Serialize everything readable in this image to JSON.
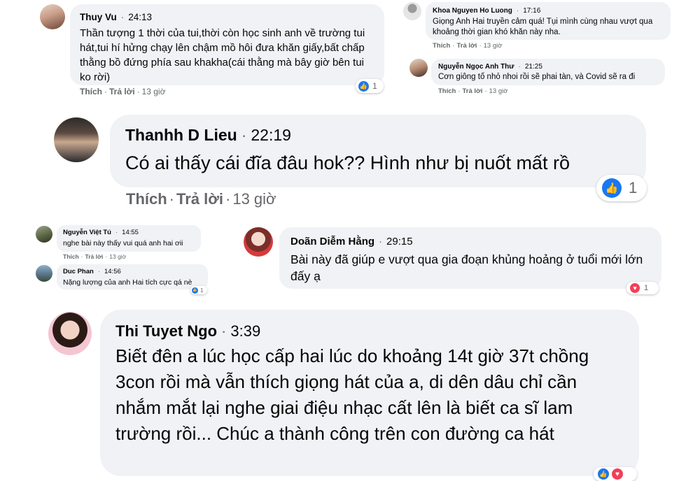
{
  "comments": [
    {
      "name": "Thuy Vu",
      "time": "24:13",
      "text": "Thần tượng 1 thời của tui,thời còn học sinh anh về trường tui hát,tui hí hửng chạy lên chậm mồ hôi đưa khăn giấy,bất chấp thằng bồ đứng phía sau khakha(cái thằng mà bây giờ bên tui ko rời)",
      "like": "Thích",
      "reply": "Trả lời",
      "ago": "13 giờ",
      "reactions": "1"
    },
    {
      "name": "Khoa Nguyen Ho Luong",
      "time": "17:16",
      "text": "Giọng Anh Hai truyền cảm quá! Tụi mình cùng nhau vượt qua khoảng thời gian khó khăn này nha.",
      "like": "Thích",
      "reply": "Trả lời",
      "ago": "13 giờ"
    },
    {
      "name": "Nguyễn Ngọc Anh Thư",
      "time": "21:25",
      "text": "Cơn giông tố nhỏ nhoi rồi sẽ phai tàn, và Covid sẽ ra đi",
      "like": "Thích",
      "reply": "Trả lời",
      "ago": "13 giờ"
    },
    {
      "name": "Thanhh D Lieu",
      "time": "22:19",
      "text": "Có ai thấy cái đĩa đâu hok?? Hình như bị nuốt mất rồ",
      "like": "Thích",
      "reply": "Trả lời",
      "ago": "13 giờ",
      "reactions": "1"
    },
    {
      "name": "Nguyễn Việt Tú",
      "time": "14:55",
      "text": "nghe bài này thấy vui quá anh hai ơii",
      "like": "Thích",
      "reply": "Trả lời",
      "ago": "13 giờ"
    },
    {
      "name": "Duc Phan",
      "time": "14:56",
      "text": "Nặng lượng của anh Hai tích cực qá nè",
      "reactions": "1"
    },
    {
      "name": "Doãn Diễm Hằng",
      "time": "29:15",
      "text": "Bài này đã giúp e vượt qua gia đoạn khủng hoảng ở tuổi mới lớn đấy ạ",
      "reactions": "1"
    },
    {
      "name": "Thi Tuyet Ngo",
      "time": "3:39",
      "text": "Biết đên a lúc học cấp hai lúc do khoảng 14t giờ 37t chồng 3con rồi mà vẫn thích giọng hát của a, di dên dâu chỉ cần nhắm mắt lại nghe giai điệu nhạc cất lên là biết ca sĩ lam trường rồi... Chúc a thành công trên con đường ca hát"
    }
  ],
  "colors": {
    "bubble": "#f0f2f5",
    "like_blue": "#1877f2",
    "heart_red": "#f33e58",
    "meta_gray": "#65676b"
  },
  "icons": {
    "like": "thumbs-up-icon",
    "love": "heart-icon"
  }
}
